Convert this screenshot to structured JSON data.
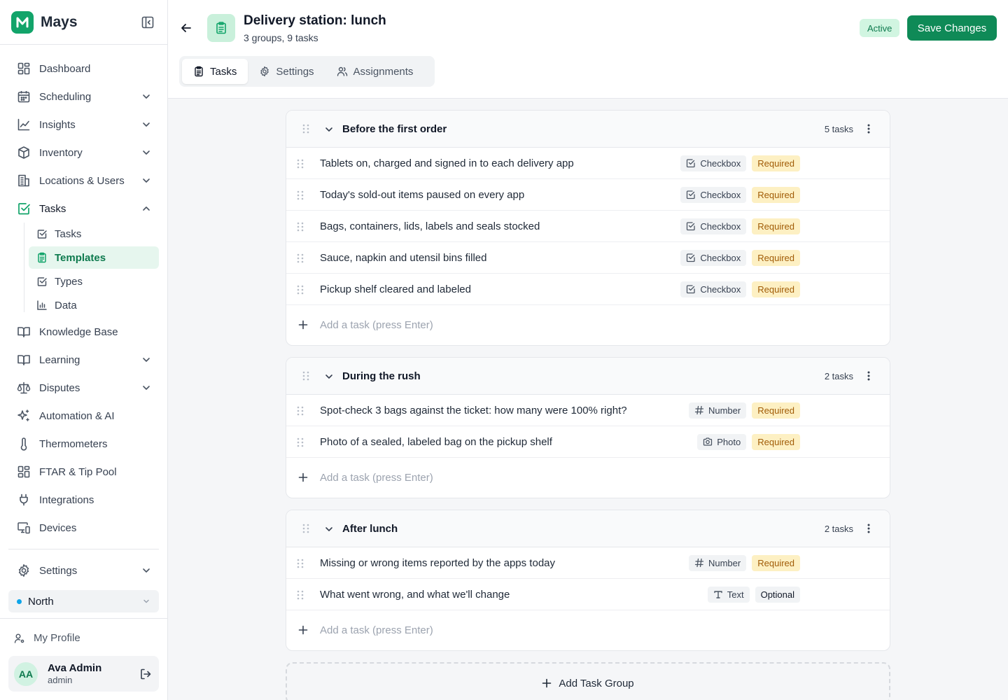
{
  "app": {
    "name": "Mays"
  },
  "sidebar": {
    "items": [
      {
        "label": "Dashboard",
        "icon": "dashboard-icon"
      },
      {
        "label": "Scheduling",
        "icon": "calendar-icon"
      },
      {
        "label": "Insights",
        "icon": "chart-line-icon"
      },
      {
        "label": "Inventory",
        "icon": "box-icon"
      },
      {
        "label": "Locations & Users",
        "icon": "building-icon"
      },
      {
        "label": "Tasks",
        "icon": "check-square-icon"
      },
      {
        "label": "Knowledge Base",
        "icon": "book-icon"
      },
      {
        "label": "Learning",
        "icon": "book-open-icon"
      },
      {
        "label": "Disputes",
        "icon": "scale-icon"
      },
      {
        "label": "Automation & AI",
        "icon": "sparkles-icon"
      },
      {
        "label": "Thermometers",
        "icon": "thermometer-icon"
      },
      {
        "label": "FTAR & Tip Pool",
        "icon": "grid-icon"
      },
      {
        "label": "Integrations",
        "icon": "plug-icon"
      },
      {
        "label": "Devices",
        "icon": "devices-icon"
      },
      {
        "label": "Settings",
        "icon": "gear-icon"
      }
    ],
    "tasks_sub": [
      {
        "label": "Tasks"
      },
      {
        "label": "Templates"
      },
      {
        "label": "Types"
      },
      {
        "label": "Data"
      }
    ],
    "location": "North",
    "profile_label": "My Profile",
    "user": {
      "initials": "AA",
      "name": "Ava Admin",
      "role": "admin"
    }
  },
  "header": {
    "title": "Delivery station: lunch",
    "subtitle": "3 groups, 9 tasks",
    "status": "Active",
    "save_label": "Save Changes",
    "tabs": [
      {
        "label": "Tasks"
      },
      {
        "label": "Settings"
      },
      {
        "label": "Assignments"
      }
    ]
  },
  "groups": [
    {
      "title": "Before the first order",
      "count": "5 tasks",
      "tasks": [
        {
          "title": "Tablets on, charged and signed in to each delivery app",
          "type": "Checkbox",
          "requirement": "Required"
        },
        {
          "title": "Today's sold-out items paused on every app",
          "type": "Checkbox",
          "requirement": "Required"
        },
        {
          "title": "Bags, containers, lids, labels and seals stocked",
          "type": "Checkbox",
          "requirement": "Required"
        },
        {
          "title": "Sauce, napkin and utensil bins filled",
          "type": "Checkbox",
          "requirement": "Required"
        },
        {
          "title": "Pickup shelf cleared and labeled",
          "type": "Checkbox",
          "requirement": "Required"
        }
      ],
      "add_placeholder": "Add a task (press Enter)"
    },
    {
      "title": "During the rush",
      "count": "2 tasks",
      "tasks": [
        {
          "title": "Spot-check 3 bags against the ticket: how many were 100% right?",
          "type": "Number",
          "requirement": "Required"
        },
        {
          "title": "Photo of a sealed, labeled bag on the pickup shelf",
          "type": "Photo",
          "requirement": "Required"
        }
      ],
      "add_placeholder": "Add a task (press Enter)"
    },
    {
      "title": "After lunch",
      "count": "2 tasks",
      "tasks": [
        {
          "title": "Missing or wrong items reported by the apps today",
          "type": "Number",
          "requirement": "Required"
        },
        {
          "title": "What went wrong, and what we'll change",
          "type": "Text",
          "requirement": "Optional"
        }
      ],
      "add_placeholder": "Add a task (press Enter)"
    }
  ],
  "add_group_label": "Add Task Group",
  "colors": {
    "brand": "#12a46a",
    "primary_button": "#0f8a57",
    "required_bg": "#fdf0c3",
    "required_text": "#a15c07",
    "active_badge_bg": "#d1f5e1",
    "location_dot": "#0ea5e9"
  }
}
